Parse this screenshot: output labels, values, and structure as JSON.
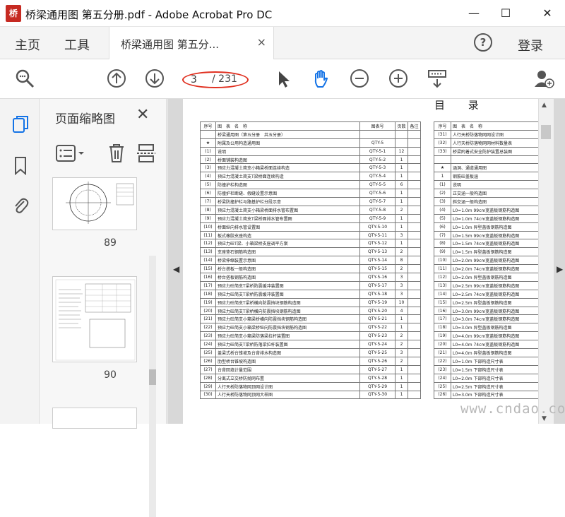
{
  "window": {
    "title": "桥梁通用图 第五分册.pdf - Adobe Acrobat Pro DC",
    "minimize": "—",
    "maximize": "☐",
    "close": "✕",
    "logo_text": "桥"
  },
  "nav": {
    "home": "主页",
    "tools": "工具",
    "doc_tab": "桥梁通用图 第五分...",
    "doc_tab_close": "×",
    "help": "?",
    "login": "登录"
  },
  "toolbar": {
    "page_current": "3",
    "page_total": "/ 231"
  },
  "thumb_panel": {
    "title": "页面缩略图",
    "close": "✕",
    "pages": [
      {
        "label": "89"
      },
      {
        "label": "90"
      }
    ]
  },
  "document": {
    "heading": "目 录",
    "left_table": {
      "headers": [
        "序号",
        "图　表　名　称",
        "图表号",
        "页数",
        "备注"
      ],
      "rows": [
        [
          "",
          "桥梁通用图（第五分册　共五分册）",
          "",
          "",
          ""
        ],
        [
          "★",
          "附属及公用构造通用图",
          "QTY-5",
          "",
          ""
        ],
        [
          "(1)",
          "说明",
          "QTY-5-1",
          "12",
          ""
        ],
        [
          "(2)",
          "桥面铺装构造图",
          "QTY-5-2",
          "1",
          ""
        ],
        [
          "(3)",
          "预应力混凝土简支小箱梁桥面连续构造",
          "QTY-5-3",
          "1",
          ""
        ],
        [
          "(4)",
          "预应力混凝土简支T梁桥面连续构造",
          "QTY-5-4",
          "1",
          ""
        ],
        [
          "(5)",
          "防撞护栏构造图",
          "QTY-5-5",
          "6",
          ""
        ],
        [
          "(6)",
          "防撞护栏断缝、假缝设置示意图",
          "QTY-5-6",
          "1",
          ""
        ],
        [
          "(7)",
          "桥梁防撞护栏与路基护栏分段示意",
          "QTY-5-7",
          "1",
          ""
        ],
        [
          "(8)",
          "预应力混凝土简支小箱梁桥面排水管布置图",
          "QTY-5-8",
          "2",
          ""
        ],
        [
          "(9)",
          "预应力混凝土简支T梁桥面排水管布置图",
          "QTY-5-9",
          "1",
          ""
        ],
        [
          "(10)",
          "桥面纵向排水管设置图",
          "QTY-5-10",
          "1",
          ""
        ],
        [
          "(11)",
          "板式橡胶支座构造",
          "QTY-5-11",
          "3",
          ""
        ],
        [
          "(12)",
          "预应力砼T梁、小箱梁桥支座调平方案",
          "QTY-5-12",
          "1",
          ""
        ],
        [
          "(13)",
          "支座垫石钢筋构造图",
          "QTY-5-13",
          "2",
          ""
        ],
        [
          "(14)",
          "桥梁伸缩装置示意图",
          "QTY-5-14",
          "8",
          ""
        ],
        [
          "(15)",
          "桥台搭板一般构造图",
          "QTY-5-15",
          "2",
          ""
        ],
        [
          "(16)",
          "桥台搭板钢筋构造图",
          "QTY-5-16",
          "3",
          ""
        ],
        [
          "(17)",
          "预应力砼简支T梁桥防震缓冲装置图",
          "QTY-5-17",
          "3",
          ""
        ],
        [
          "(18)",
          "预应力砼简支T梁桥防震缓冲装置图",
          "QTY-5-18",
          "3",
          ""
        ],
        [
          "(19)",
          "预应力砼简支T梁桥横向防震挡块钢筋构造图",
          "QTY-5-19",
          "10",
          ""
        ],
        [
          "(20)",
          "预应力砼简支T梁桥横向防震挡块钢筋构造图",
          "QTY-5-20",
          "4",
          ""
        ],
        [
          "(21)",
          "预应力砼简支小箱梁桥横向防震挡块钢筋构造图",
          "QTY-5-21",
          "1",
          ""
        ],
        [
          "(22)",
          "预应力砼简支小箱梁桥纵向防震挡块钢筋构造图",
          "QTY-5-22",
          "1",
          ""
        ],
        [
          "(23)",
          "预应力砼简支小箱梁防落梁拉杆装置图",
          "QTY-5-23",
          "2",
          ""
        ],
        [
          "(24)",
          "预应力砼简支T梁桥防落梁拉杆装置图",
          "QTY-5-24",
          "2",
          ""
        ],
        [
          "(25)",
          "盖梁式桥台锥坡及台背排水构造图",
          "QTY-5-25",
          "3",
          ""
        ],
        [
          "(26)",
          "肋型桥台锥坡构造图",
          "QTY-5-26",
          "2",
          ""
        ],
        [
          "(27)",
          "台背回填计量范围",
          "QTY-5-27",
          "1",
          ""
        ],
        [
          "(28)",
          "分离式立交桥防抛网布置",
          "QTY-5-28",
          "1",
          ""
        ],
        [
          "(29)",
          "人行天桥防落物网顶网设计图",
          "QTY-5-29",
          "1",
          ""
        ],
        [
          "(30)",
          "人行天桥防落物网顶网大样图",
          "QTY-5-30",
          "1",
          ""
        ]
      ]
    },
    "right_table": {
      "headers": [
        "序号",
        "图　表　名　称"
      ],
      "rows": [
        [
          "(31)",
          "人行天桥防落物网网设计图"
        ],
        [
          "(32)",
          "人行天桥防落物网网材料数量表"
        ],
        [
          "(33)",
          "桥梁附着式安全防护装置总装图"
        ],
        [
          "",
          ""
        ],
        [
          "★",
          "涵洞、通道通用图"
        ],
        [
          "1",
          "钢筋砼盖板涵"
        ],
        [
          "(1)",
          "说明"
        ],
        [
          "(2)",
          "正交涵一般构造图"
        ],
        [
          "(3)",
          "斜交涵一般构造图"
        ],
        [
          "(4)",
          "L0=1.0m 99cm宽盖板钢筋构造图"
        ],
        [
          "(5)",
          "L0=1.0m 74cm宽盖板钢筋构造图"
        ],
        [
          "(6)",
          "L0=1.0m 异型盖板钢筋构造图"
        ],
        [
          "(7)",
          "L0=1.5m 99cm宽盖板钢筋构造图"
        ],
        [
          "(8)",
          "L0=1.5m 74cm宽盖板钢筋构造图"
        ],
        [
          "(9)",
          "L0=1.5m 异型盖板钢筋构造图"
        ],
        [
          "(10)",
          "L0=2.0m 99cm宽盖板钢筋构造图"
        ],
        [
          "(11)",
          "L0=2.0m 74cm宽盖板钢筋构造图"
        ],
        [
          "(12)",
          "L0=2.0m 异型盖板钢筋构造图"
        ],
        [
          "(13)",
          "L0=2.5m 99cm宽盖板钢筋构造图"
        ],
        [
          "(14)",
          "L0=2.5m 74cm宽盖板钢筋构造图"
        ],
        [
          "(15)",
          "L0=2.5m 异型盖板钢筋构造图"
        ],
        [
          "(16)",
          "L0=3.0m 99cm宽盖板钢筋构造图"
        ],
        [
          "(17)",
          "L0=3.0m 74cm宽盖板钢筋构造图"
        ],
        [
          "(18)",
          "L0=3.0m 异型盖板钢筋构造图"
        ],
        [
          "(19)",
          "L0=4.0m 99cm宽盖板钢筋构造图"
        ],
        [
          "(20)",
          "L0=4.0m 74cm宽盖板钢筋构造图"
        ],
        [
          "(21)",
          "L0=4.0m 异型盖板钢筋构造图"
        ],
        [
          "(22)",
          "L0=1.0m 下部构造尺寸表"
        ],
        [
          "(23)",
          "L0=1.5m 下部构造尺寸表"
        ],
        [
          "(24)",
          "L0=2.0m 下部构造尺寸表"
        ],
        [
          "(25)",
          "L0=2.5m 下部构造尺寸表"
        ],
        [
          "(26)",
          "L0=3.0m 下部构造尺寸表"
        ]
      ]
    }
  },
  "watermark": "www.cndao.com",
  "colors": {
    "accent_blue": "#1473e6",
    "annotation_red": "#e03020",
    "logo_red": "#c62a22"
  }
}
